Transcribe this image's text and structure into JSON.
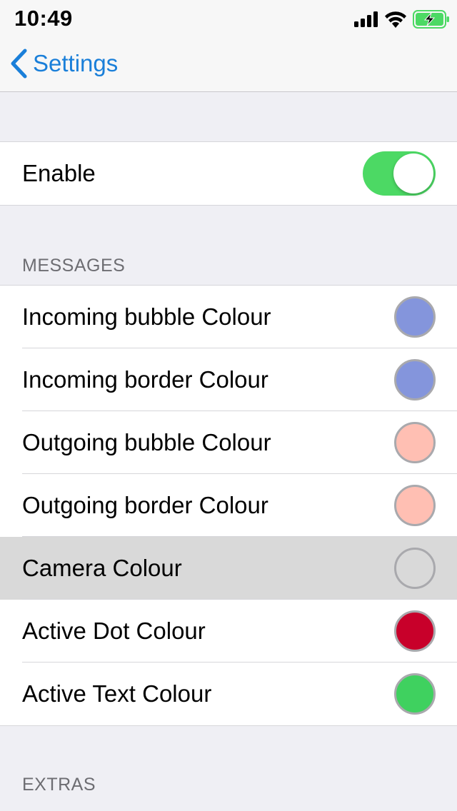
{
  "status_bar": {
    "time": "10:49",
    "signal_icon": "cellular-signal-icon",
    "wifi_icon": "wifi-icon",
    "battery_icon": "battery-charging-icon",
    "battery_color": "#4cd964"
  },
  "nav": {
    "back_label": "Settings",
    "back_icon": "chevron-left-icon",
    "accent_color": "#1a7fd9"
  },
  "enable": {
    "label": "Enable",
    "on": true,
    "toggle_color": "#4cd964"
  },
  "messages": {
    "header": "MESSAGES",
    "items": [
      {
        "label": "Incoming bubble Colour",
        "color": "#8495dc",
        "highlighted": false
      },
      {
        "label": "Incoming border Colour",
        "color": "#8495dc",
        "highlighted": false
      },
      {
        "label": "Outgoing bubble Colour",
        "color": "#ffbfb3",
        "highlighted": false
      },
      {
        "label": "Outgoing border Colour",
        "color": "#ffbfb3",
        "highlighted": false
      },
      {
        "label": "Camera Colour",
        "color": "#d9d9d9",
        "highlighted": true
      },
      {
        "label": "Active Dot Colour",
        "color": "#c8002a",
        "highlighted": false
      },
      {
        "label": "Active Text Colour",
        "color": "#3fd15f",
        "highlighted": false
      }
    ]
  },
  "extras": {
    "header": "EXTRAS"
  }
}
